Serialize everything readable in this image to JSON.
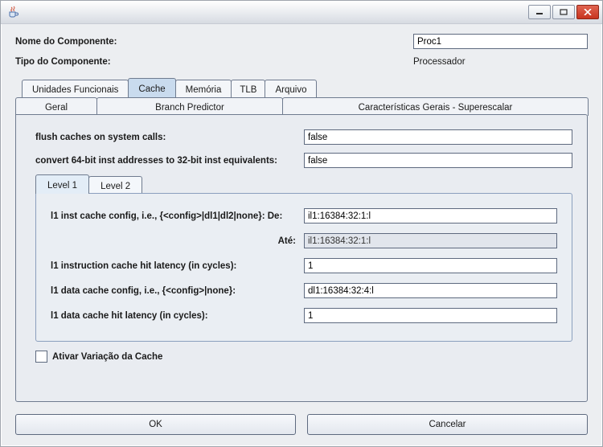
{
  "window": {
    "title": "",
    "icon": "java-cup-icon"
  },
  "labels": {
    "component_name": "Nome do Componente:",
    "component_type": "Tipo do Componente:",
    "component_type_value": "Processador"
  },
  "inputs": {
    "component_name_value": "Proc1"
  },
  "top_tabs": [
    {
      "id": "unidades",
      "label": "Unidades Funcionais"
    },
    {
      "id": "cache",
      "label": "Cache"
    },
    {
      "id": "memoria",
      "label": "Memória"
    },
    {
      "id": "tlb",
      "label": "TLB"
    },
    {
      "id": "arquivo",
      "label": "Arquivo"
    }
  ],
  "sub_tabs": [
    {
      "id": "geral",
      "label": "Geral"
    },
    {
      "id": "branch",
      "label": "Branch Predictor"
    },
    {
      "id": "carac",
      "label": "Características Gerais - Superescalar"
    }
  ],
  "cache_panel": {
    "flush_label": "flush caches on system calls:",
    "flush_value": "false",
    "convert_label": "convert 64-bit inst addresses to 32-bit inst equivalents:",
    "convert_value": "false",
    "level_tabs": [
      {
        "id": "l1",
        "label": "Level 1"
      },
      {
        "id": "l2",
        "label": "Level 2"
      }
    ],
    "level1": {
      "row1_label": "l1 inst cache config, i.e., {<config>|dl1|dl2|none}:   De:",
      "row1_value": "il1:16384:32:1:l",
      "row2_label": "Até:",
      "row2_value": "il1:16384:32:1:l",
      "row3_label": "l1 instruction cache hit latency (in cycles):",
      "row3_value": "1",
      "row4_label": "l1 data cache config, i.e., {<config>|none}:",
      "row4_value": "dl1:16384:32:4:l",
      "row5_label": "l1 data cache hit latency (in cycles):",
      "row5_value": "1"
    },
    "checkbox_label": "Ativar Variação da Cache",
    "checkbox_checked": false
  },
  "buttons": {
    "ok": "OK",
    "cancel": "Cancelar"
  }
}
